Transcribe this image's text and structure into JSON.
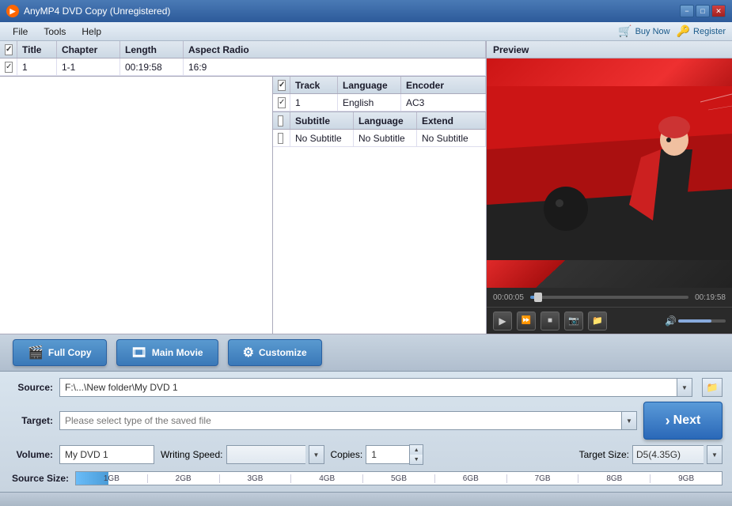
{
  "titlebar": {
    "title": "AnyMP4 DVD Copy (Unregistered)",
    "icon": "◉",
    "min": "−",
    "max": "□",
    "close": "✕"
  },
  "menubar": {
    "items": [
      "File",
      "Tools",
      "Help"
    ],
    "buy_btn": "Buy Now",
    "register_btn": "Register"
  },
  "video_table": {
    "columns": [
      "",
      "Title",
      "Chapter",
      "Length",
      "Aspect Radio"
    ],
    "rows": [
      {
        "checked": true,
        "title": "1",
        "chapter": "1-1",
        "length": "00:19:58",
        "aspect": "16:9"
      }
    ]
  },
  "audio_table": {
    "columns": [
      "",
      "Track",
      "Language",
      "Encoder"
    ],
    "rows": [
      {
        "checked": true,
        "track": "1",
        "language": "English",
        "encoder": "AC3"
      }
    ]
  },
  "subtitle_table": {
    "columns": [
      "",
      "Subtitle",
      "Language",
      "Extend"
    ],
    "rows": [
      {
        "checked": false,
        "subtitle": "No Subtitle",
        "language": "No Subtitle",
        "extend": "No Subtitle"
      }
    ]
  },
  "preview": {
    "label": "Preview"
  },
  "player": {
    "time_start": "00:00:05",
    "time_end": "00:19:58",
    "progress_pct": 5
  },
  "action_buttons": {
    "full_copy": "Full Copy",
    "main_movie": "Main Movie",
    "customize": "Customize"
  },
  "bottom": {
    "source_label": "Source:",
    "source_value": "F:\\...\\New folder\\My DVD 1",
    "target_label": "Target:",
    "target_placeholder": "Please select type of the saved file",
    "volume_label": "Volume:",
    "volume_value": "My DVD 1",
    "writing_speed_label": "Writing Speed:",
    "writing_speed_value": "",
    "copies_label": "Copies:",
    "copies_value": "1",
    "target_size_label": "Target Size:",
    "target_size_value": "D5(4.35G)",
    "source_size_label": "Source Size:",
    "size_labels": [
      "1GB",
      "2GB",
      "3GB",
      "4GB",
      "5GB",
      "6GB",
      "7GB",
      "8GB",
      "9GB"
    ],
    "next_label": "Next"
  }
}
